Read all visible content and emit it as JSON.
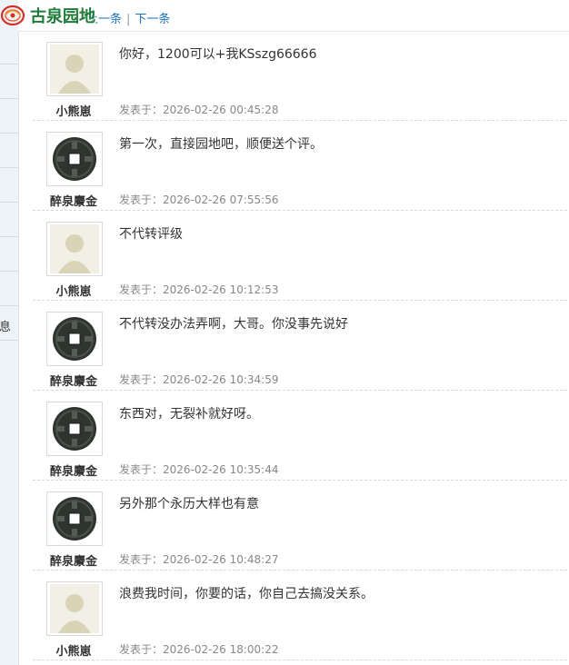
{
  "sidebar": {
    "label": "息"
  },
  "header": {
    "logo_text": "古泉园地",
    "prev_label": "上一条",
    "separator": "|",
    "next_label": "下一条"
  },
  "meta_prefix": "发表于：",
  "posts": [
    {
      "user": "小熊崽",
      "avatar": "default-avatar",
      "content": "你好，1200可以+我KSszg66666",
      "time": "2026-02-26 00:45:28"
    },
    {
      "user": "醉泉麖金",
      "avatar": "coin-avatar",
      "content": "第一次，直接园地吧，顺便送个评。",
      "time": "2026-02-26 07:55:56"
    },
    {
      "user": "小熊崽",
      "avatar": "default-avatar",
      "content": "不代转评级",
      "time": "2026-02-26 10:12:53"
    },
    {
      "user": "醉泉麖金",
      "avatar": "coin-avatar",
      "content": "不代转没办法弄啊，大哥。你没事先说好",
      "time": "2026-02-26 10:34:59"
    },
    {
      "user": "醉泉麖金",
      "avatar": "coin-avatar",
      "content": "东西对，无裂补就好呀。",
      "time": "2026-02-26 10:35:44"
    },
    {
      "user": "醉泉麖金",
      "avatar": "coin-avatar",
      "content": "另外那个永历大样也有意",
      "time": "2026-02-26 10:48:27"
    },
    {
      "user": "小熊崽",
      "avatar": "default-avatar",
      "content": "浪费我时间，你要的话，你自己去搞没关系。",
      "time": "2026-02-26 18:00:22"
    }
  ]
}
